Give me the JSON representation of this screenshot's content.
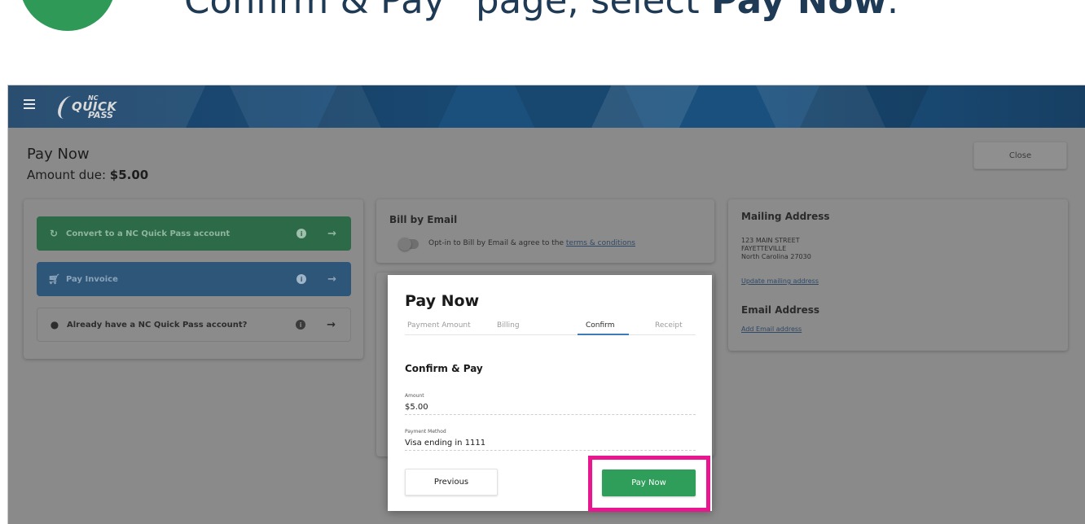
{
  "instruction": {
    "text_prefix": "Confirm & Pay” page, select ",
    "text_bold": "Pay Now",
    "text_suffix": "."
  },
  "header": {
    "logo_nc": "NC",
    "logo_quick": "QUICK",
    "logo_pass": "PASS"
  },
  "page": {
    "title": "Pay Now",
    "amount_due_label": "Amount due: ",
    "amount_due_value": "$5.00",
    "close_label": "Close"
  },
  "actions": [
    {
      "label": "Convert to a NC Quick Pass account",
      "icon": "refresh-icon"
    },
    {
      "label": "Pay Invoice",
      "icon": "cart-icon"
    },
    {
      "label": "Already have a NC Quick Pass account?",
      "icon": "user-icon"
    }
  ],
  "bill_by_email": {
    "title": "Bill by Email",
    "optin_text": "Opt-in to Bill by Email & agree to the ",
    "terms_link": "terms & conditions"
  },
  "mailing": {
    "title": "Mailing Address",
    "line1": "123 MAIN STREET",
    "line2": "FAYETTEVILLE",
    "line3": "North Carolina 27030",
    "update_link": "Update mailing address",
    "email_title": "Email Address",
    "email_link": "Add Email address"
  },
  "modal": {
    "title": "Pay Now",
    "steps": [
      "Payment Amount",
      "Billing",
      "Confirm",
      "Receipt"
    ],
    "active_step": "Confirm",
    "section_title": "Confirm & Pay",
    "amount_label": "Amount",
    "amount_value": "$5.00",
    "method_label": "Payment Method",
    "method_value": "Visa ending in 1111",
    "previous_label": "Previous",
    "pay_label": "Pay Now"
  },
  "colors": {
    "accent_green": "#2f9e5a",
    "highlight_pink": "#e9178f",
    "tab_underline": "#3e79b8"
  }
}
